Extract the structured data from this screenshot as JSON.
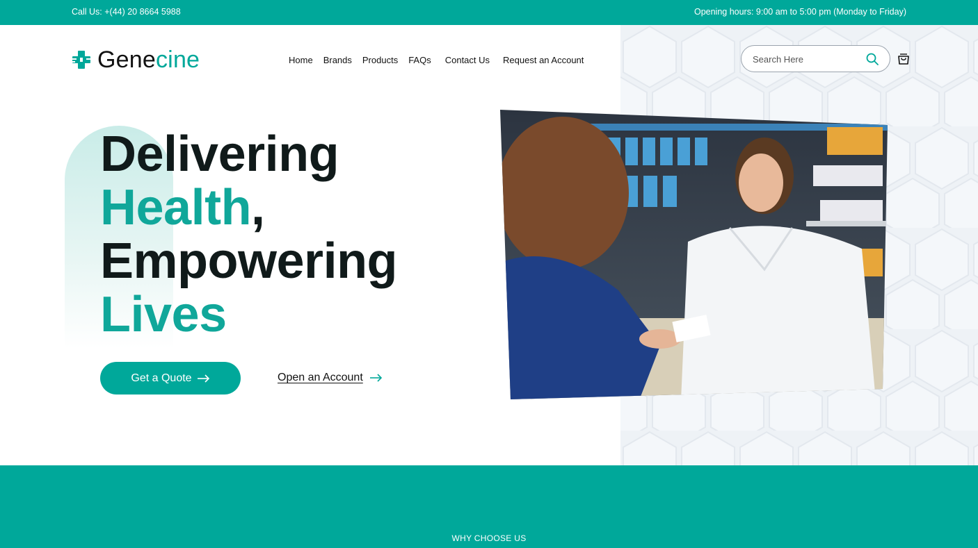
{
  "topbar": {
    "call": "Call Us: +(44) 20 8664 5988",
    "hours": "Opening hours: 9:00 am to 5:00 pm (Monday to Friday)"
  },
  "logo": {
    "part1": "Gene",
    "part2": "cine",
    "icon": "medical-cross-icon"
  },
  "nav": {
    "items": [
      "Home",
      "Brands",
      "Products",
      "FAQs",
      "Contact Us",
      "Request an Account"
    ]
  },
  "search": {
    "placeholder": "Search Here",
    "icon": "search-icon"
  },
  "cart": {
    "icon": "shopping-bag-icon"
  },
  "hero": {
    "line1": "Delivering",
    "line2a": "Health",
    "line2b": ",",
    "line3": "Empowering",
    "line4": "Lives",
    "quote_button": "Get a Quote",
    "account_link": "Open an Account",
    "image_alt": "Pharmacist handing product to customer at pharmacy counter"
  },
  "why": {
    "label": "WHY CHOOSE US"
  },
  "colors": {
    "accent": "#00a89a",
    "dark": "#101a1a",
    "hex_bg": "#eef2f6"
  }
}
